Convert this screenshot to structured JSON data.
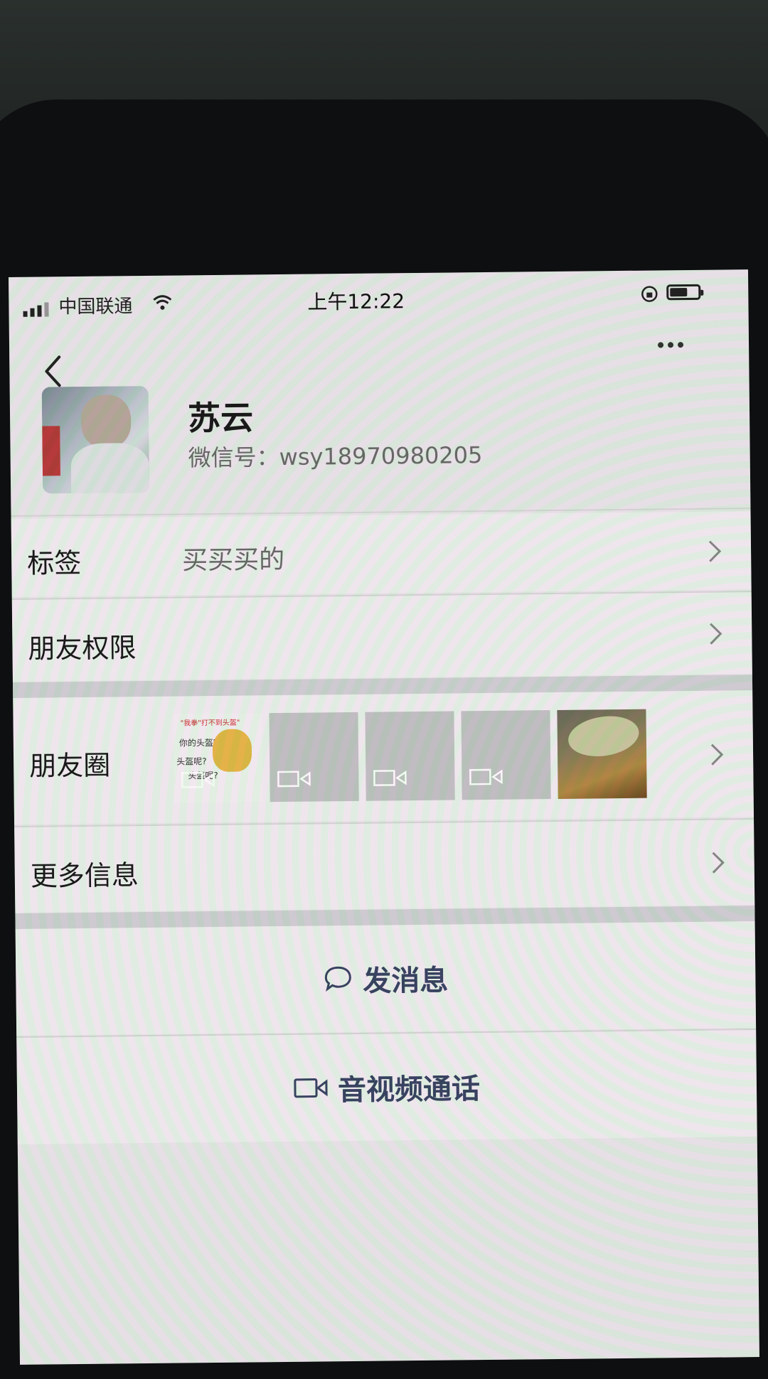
{
  "status_bar": {
    "carrier": "中国联通",
    "time": "上午12:22"
  },
  "profile": {
    "name": "苏云",
    "wechat_id": "微信号：wsy18970980205"
  },
  "rows": {
    "tags_label": "标签",
    "tags_value": "买买买的",
    "friend_permissions_label": "朋友权限",
    "moments_label": "朋友圈",
    "more_info_label": "更多信息"
  },
  "moments_thumbnails": [
    {
      "type": "gif",
      "banner": "\"我拳\"打不到头盔\"",
      "line1": "你的头盔呢?",
      "line2": "头盔呢?",
      "line3": "头盔呢?"
    },
    {
      "type": "video"
    },
    {
      "type": "video"
    },
    {
      "type": "video"
    },
    {
      "type": "photo"
    }
  ],
  "actions": {
    "send_message": "发消息",
    "video_call": "音视频通话"
  },
  "icons": {
    "back": "chevron-left-icon",
    "more": "more-dots-icon",
    "chat": "chat-bubble-icon",
    "video": "video-camera-icon"
  }
}
